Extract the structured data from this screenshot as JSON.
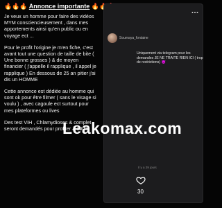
{
  "announcement": {
    "fire_left": "🔥🔥🔥",
    "heading": "Annonce importante",
    "fire_right": "🔥🔥🔥",
    "paragraphs": [
      "Je veux un homme pour faire des vidéos MYM consciencieusement , dans mes apportements ainsi qu'en public ou en voyage ect ...",
      "Pour le profit l'origine je m'en fiche, c'est avant tout une question de taille de bite ( Une bonne grosses ) & de moyen financier ( j'appelle il rapplique , il appel je rapplique ) En dessous de 25 an pitier j'ai dis un HOMME",
      "Cette annonce est dédiée au homme qui sont ok pour être filmer ( sans le visage si voulu ) , avec cagoule ect surtout pour mes plateformes ou lives",
      "Des test VIH , Chlamydioses & complet seront demandés pour profiter à 100%"
    ]
  },
  "post": {
    "username": "Soumaya_fontaine",
    "text": "Uniquement via telegram pour les demandes JE NE TRAITE RIEN ICI ( trop de restrictions) 😈",
    "timestamp": "Il y a 29 jours",
    "like_count": "30"
  },
  "watermark": "Leakomax.com",
  "colors": {
    "background": "#050505",
    "card": "#1c1c1e",
    "text": "#ffffff",
    "muted": "#8a8a8a"
  }
}
